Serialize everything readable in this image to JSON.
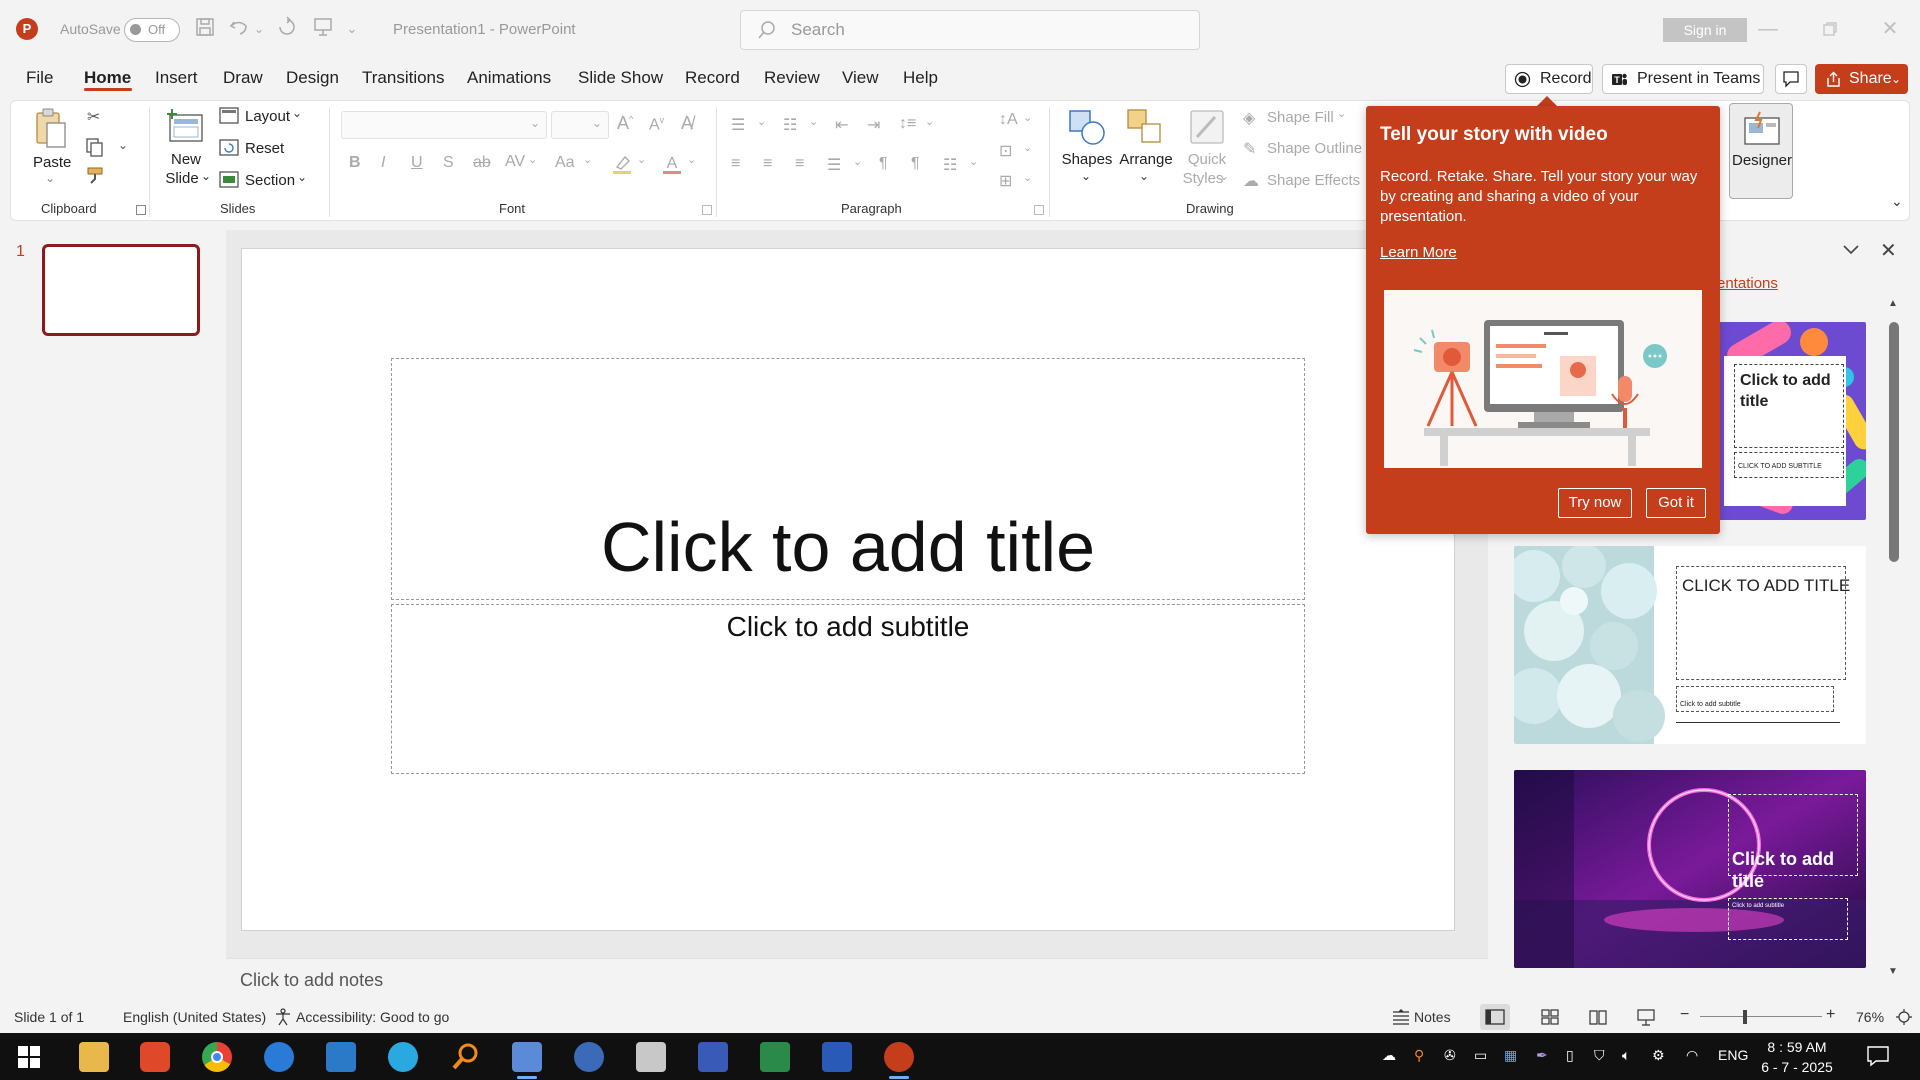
{
  "titlebar": {
    "autosave_label": "AutoSave",
    "autosave_state": "Off",
    "doc_title": "Presentation1  -  PowerPoint",
    "search_placeholder": "Search",
    "signin_label": "Sign in"
  },
  "tabs": [
    "File",
    "Home",
    "Insert",
    "Draw",
    "Design",
    "Transitions",
    "Animations",
    "Slide Show",
    "Record",
    "Review",
    "View",
    "Help"
  ],
  "active_tab": "Home",
  "top_buttons": {
    "record": "Record",
    "present": "Present in Teams",
    "share": "Share"
  },
  "ribbon": {
    "clipboard": {
      "paste": "Paste",
      "group": "Clipboard"
    },
    "slides": {
      "new_slide_1": "New",
      "new_slide_2": "Slide",
      "layout": "Layout",
      "reset": "Reset",
      "section": "Section",
      "group": "Slides"
    },
    "font": {
      "group": "Font"
    },
    "paragraph": {
      "group": "Paragraph"
    },
    "drawing": {
      "shapes": "Shapes",
      "arrange": "Arrange",
      "quick_1": "Quick",
      "quick_2": "Styles",
      "shape_fill": "Shape Fill",
      "shape_outline": "Shape Outline",
      "shape_effects": "Shape Effects",
      "group": "Drawing"
    },
    "designer": "Designer"
  },
  "thumbnails": {
    "slide_number": "1"
  },
  "slide": {
    "title_placeholder": "Click to add title",
    "subtitle_placeholder": "Click to add subtitle"
  },
  "notes_placeholder": "Click to add notes",
  "designer_pane": {
    "link_text": "entations",
    "card1_title": "Click to add title",
    "card1_subtitle": "CLICK TO ADD SUBTITLE",
    "card2_title": "CLICK TO ADD TITLE",
    "card2_subtitle": "Click to add subtitle",
    "card3_title": "Click to add title",
    "card3_subtitle": "Click to add subtitle"
  },
  "popup": {
    "heading": "Tell your story with video",
    "body": "Record. Retake. Share. Tell your story your way by creating and sharing a video of your presentation.",
    "learn_more": "Learn More",
    "try_now": "Try now",
    "got_it": "Got it"
  },
  "statusbar": {
    "slide_info": "Slide 1 of 1",
    "language": "English (United States)",
    "accessibility": "Accessibility: Good to go",
    "notes": "Notes",
    "zoom": "76%",
    "zoom_value": 76
  },
  "taskbar": {
    "language": "ENG",
    "time": "8 : 59 AM",
    "date": "6 - 7 - 2025"
  },
  "colors": {
    "accent": "#c43e1c",
    "thumb_border": "#8e1b1b",
    "taskbar": "#101010"
  }
}
